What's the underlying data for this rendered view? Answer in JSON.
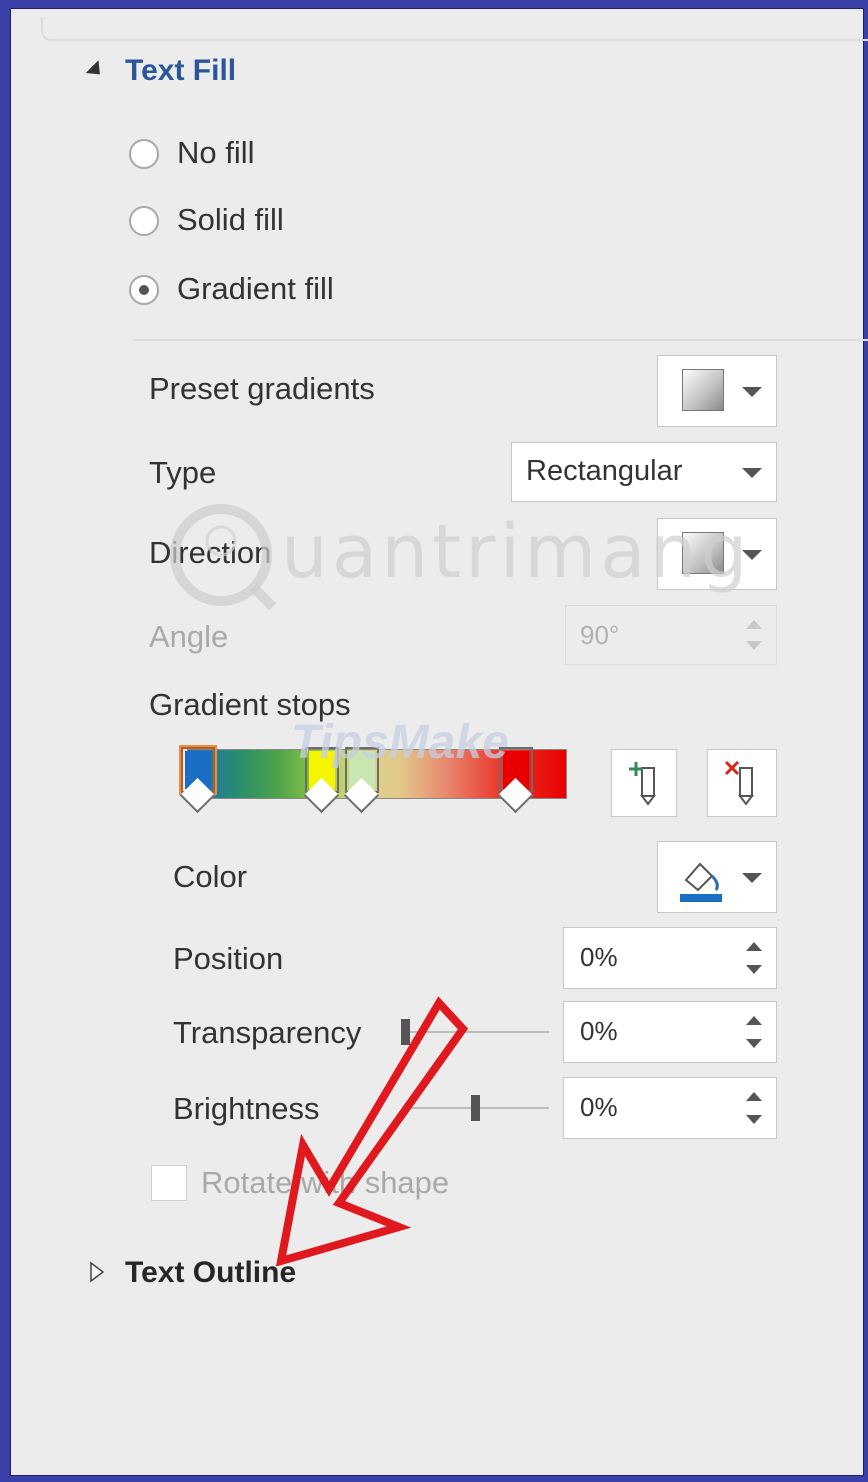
{
  "text_fill": {
    "title": "Text Fill",
    "options": [
      {
        "label": "No fill",
        "selected": false
      },
      {
        "label": "Solid fill",
        "selected": false
      },
      {
        "label": "Gradient fill",
        "selected": true
      }
    ]
  },
  "gradient": {
    "preset_label": "Preset gradients",
    "type_label": "Type",
    "type_value": "Rectangular",
    "direction_label": "Direction",
    "angle_label": "Angle",
    "angle_value": "90°",
    "stops_label": "Gradient stops",
    "stop_colors": [
      "#1a6fc4",
      "#f5f500",
      "#c8e6b0",
      "#e80000"
    ],
    "color_label": "Color",
    "position_label": "Position",
    "position_value": "0%",
    "transparency_label": "Transparency",
    "transparency_value": "0%",
    "brightness_label": "Brightness",
    "brightness_value": "0%",
    "rotate_label": "Rotate with shape"
  },
  "text_outline": {
    "title": "Text Outline"
  },
  "watermarks": {
    "primary": "uantrimang",
    "secondary": "TipsMake"
  },
  "colors": {
    "section_title": "#2b579a",
    "outline_title": "#262626",
    "annotation_arrow": "#e0191e",
    "frame": "#3b3fa8"
  }
}
